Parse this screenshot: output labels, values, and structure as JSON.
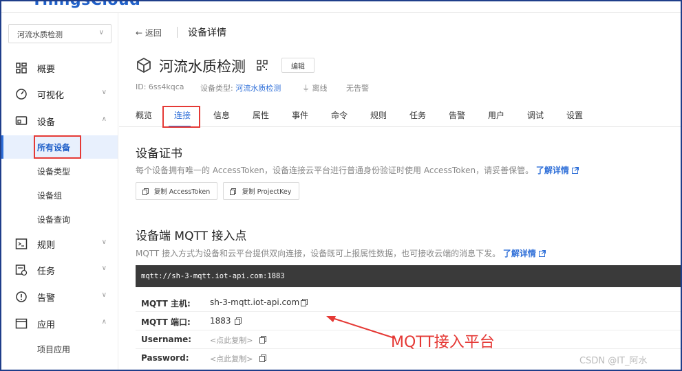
{
  "app": {
    "logo": "ThingsCloud"
  },
  "sidebar": {
    "project": "河流水质检测",
    "menu": [
      {
        "label": "概要",
        "icon": "dashboard-icon"
      },
      {
        "label": "可视化",
        "icon": "gauge-icon",
        "chevron": "down"
      },
      {
        "label": "设备",
        "icon": "device-icon",
        "chevron": "up"
      },
      {
        "label": "规则",
        "icon": "terminal-icon",
        "chevron": "down"
      },
      {
        "label": "任务",
        "icon": "task-icon",
        "chevron": "down"
      },
      {
        "label": "告警",
        "icon": "alert-icon",
        "chevron": "down"
      },
      {
        "label": "应用",
        "icon": "app-window-icon",
        "chevron": "up"
      }
    ],
    "device_sub": [
      "所有设备",
      "设备类型",
      "设备组",
      "设备查询"
    ],
    "app_sub": [
      "项目应用"
    ],
    "active_sub": "所有设备"
  },
  "header": {
    "back": "返回",
    "page_title": "设备详情"
  },
  "device": {
    "name": "河流水质检测",
    "edit": "编辑",
    "id_label": "ID: 6ss4kqca",
    "type_label": "设备类型:",
    "type_value": "河流水质检测",
    "status": "离线",
    "alert": "无告警"
  },
  "tabs": [
    "概览",
    "连接",
    "信息",
    "属性",
    "事件",
    "命令",
    "规则",
    "任务",
    "告警",
    "用户",
    "调试",
    "设置"
  ],
  "active_tab": "连接",
  "cert": {
    "title": "设备证书",
    "desc": "每个设备拥有唯一的 AccessToken，设备连接云平台进行普通身份验证时使用 AccessToken，请妥善保管。",
    "more": "了解详情",
    "btn_token": "复制 AccessToken",
    "btn_key": "复制 ProjectKey"
  },
  "mqtt": {
    "title": "设备端 MQTT 接入点",
    "desc": "MQTT 接入方式为设备和云平台提供双向连接，设备既可上报属性数据，也可接收云端的消息下发。",
    "more": "了解详情",
    "url": "mqtt://sh-3-mqtt.iot-api.com:1883",
    "rows": [
      {
        "k": "MQTT 主机:",
        "v": "sh-3-mqtt.iot-api.com"
      },
      {
        "k": "MQTT 端口:",
        "v": "1883"
      },
      {
        "k": "Username:",
        "v": "<点此复制>"
      },
      {
        "k": "Password:",
        "v": "<点此复制>"
      }
    ]
  },
  "annotation": "MQTT接入平台",
  "watermark": "CSDN @IT_阿水",
  "colors": {
    "accent": "#2f6fd8",
    "highlight": "#e53935",
    "code_bg": "#3a3a3a"
  }
}
